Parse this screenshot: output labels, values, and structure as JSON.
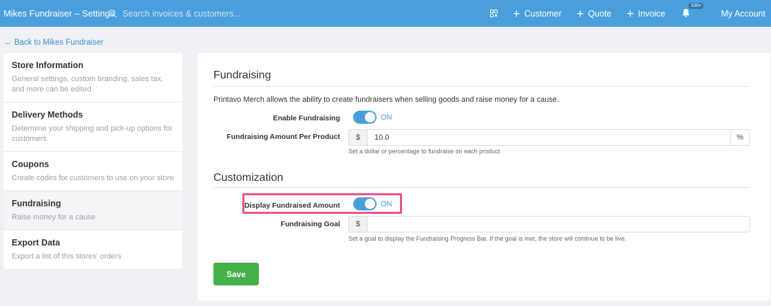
{
  "topbar": {
    "title": "Mikes Fundraiser – Settings",
    "search_placeholder": "Search invoices & customers...",
    "nav": {
      "customer": "Customer",
      "quote": "Quote",
      "invoice": "Invoice"
    },
    "notifications_badge": "100+",
    "account": "My Account"
  },
  "back_link": "← Back to Mikes Fundraiser",
  "sidebar": {
    "items": [
      {
        "title": "Store Information",
        "desc": "General settings, custom branding, sales tax, and more can be edited"
      },
      {
        "title": "Delivery Methods",
        "desc": "Determine your shipping and pick-up options for customers"
      },
      {
        "title": "Coupons",
        "desc": "Create codes for customers to use on your store"
      },
      {
        "title": "Fundraising",
        "desc": "Raise money for a cause"
      },
      {
        "title": "Export Data",
        "desc": "Export a list of this stores' orders"
      }
    ]
  },
  "fundraising": {
    "heading": "Fundraising",
    "intro": "Printavo Merch allows the ability to create fundraisers when selling goods and raise money for a cause.",
    "enable_label": "Enable Fundraising",
    "enable_state": "ON",
    "amount_label": "Fundraising Amount Per Product",
    "amount_prefix": "$",
    "amount_value": "10.0",
    "amount_suffix": "%",
    "amount_help": "Set a dollar or percentage to fundraise on each product"
  },
  "customization": {
    "heading": "Customization",
    "display_label": "Display Fundraised Amount",
    "display_state": "ON",
    "goal_label": "Fundraising Goal",
    "goal_prefix": "$",
    "goal_value": "",
    "goal_help": "Set a goal to display the Fundraising Progress Bar. If the goal is met, the store will continue to be live."
  },
  "save_label": "Save",
  "colors": {
    "topbar": "#4a9fdb",
    "highlight": "#e8528d",
    "save": "#46b04a"
  }
}
